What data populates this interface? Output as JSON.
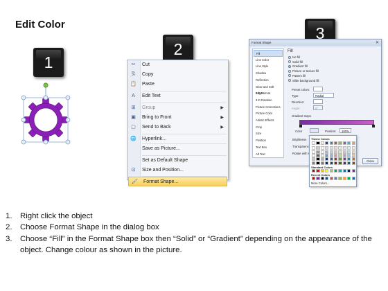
{
  "title": "Edit Color",
  "badges": [
    "1",
    "2",
    "3"
  ],
  "context_menu": {
    "items": [
      {
        "label": "Cut",
        "icon": "scissors-icon",
        "glyph": "✂",
        "disabled": false,
        "submenu": false
      },
      {
        "label": "Copy",
        "icon": "copy-icon",
        "glyph": "⎘",
        "disabled": false,
        "submenu": false
      },
      {
        "label": "Paste",
        "icon": "paste-icon",
        "glyph": "📋",
        "disabled": false,
        "submenu": false
      },
      {
        "label": "Edit Text",
        "icon": "edit-text-icon",
        "glyph": "A",
        "disabled": false,
        "submenu": false
      },
      {
        "label": "Group",
        "icon": "group-icon",
        "glyph": "⊞",
        "disabled": true,
        "submenu": true
      },
      {
        "label": "Bring to Front",
        "icon": "bring-front-icon",
        "glyph": "▣",
        "disabled": false,
        "submenu": true
      },
      {
        "label": "Send to Back",
        "icon": "send-back-icon",
        "glyph": "▢",
        "disabled": false,
        "submenu": true
      },
      {
        "label": "Hyperlink...",
        "icon": "hyperlink-icon",
        "glyph": "🌐",
        "disabled": false,
        "submenu": false
      },
      {
        "label": "Save as Picture...",
        "icon": "",
        "glyph": "",
        "disabled": false,
        "submenu": false
      },
      {
        "label": "Set as Default Shape",
        "icon": "",
        "glyph": "",
        "disabled": false,
        "submenu": false
      },
      {
        "label": "Size and Position...",
        "icon": "size-position-icon",
        "glyph": "⊡",
        "disabled": false,
        "submenu": false
      },
      {
        "label": "Format Shape...",
        "icon": "format-shape-icon",
        "glyph": "🖌",
        "disabled": false,
        "submenu": false,
        "highlight": true
      }
    ]
  },
  "dialog": {
    "title": "Format Shape",
    "close_glyph": "✕",
    "nav": [
      "Fill",
      "Line Color",
      "Line Style",
      "Shadow",
      "Reflection",
      "Glow and Soft Edges",
      "3-D Format",
      "3-D Rotation",
      "Picture Corrections",
      "Picture Color",
      "Artistic Effects",
      "Crop",
      "Size",
      "Position",
      "Text Box",
      "Alt Text"
    ],
    "section_heading": "Fill",
    "options": [
      "No fill",
      "Solid fill",
      "Gradient fill",
      "Picture or texture fill",
      "Pattern fill",
      "Slide background fill"
    ],
    "selected_option": "Gradient fill",
    "labels": {
      "preset": "Preset colors:",
      "type": "Type:",
      "type_value": "Radial",
      "direction": "Direction:",
      "angle": "Angle:",
      "angle_value": "0°",
      "stops": "Gradient stops",
      "color": "Color",
      "position": "Position:",
      "position_value": "100%",
      "brightness": "Brightness",
      "transparency": "Transparency",
      "rotate": "Rotate with shape",
      "close": "Close"
    },
    "gradient_colors": [
      "#7a2fa0",
      "#c760c8"
    ]
  },
  "palette": {
    "theme_label": "Theme Colors",
    "standard_label": "Standard Colors",
    "recent_label": "Recent Colors",
    "more_label": "More Colors...",
    "theme_top": [
      "#ffffff",
      "#000000",
      "#eeece1",
      "#1f497d",
      "#4f81bd",
      "#c0504d",
      "#9bbb59",
      "#8064a2",
      "#4bacc6",
      "#f79646"
    ],
    "standard": [
      "#c00000",
      "#ff0000",
      "#ffc000",
      "#ffff00",
      "#92d050",
      "#00b050",
      "#00b0f0",
      "#0070c0",
      "#002060",
      "#7030a0"
    ],
    "recent": [
      "#c00000",
      "#7030a0",
      "#000000",
      "#1f497d",
      "#c0504d",
      "#4f81bd",
      "#9bbb59",
      "#f79646",
      "#00b050",
      "#0070c0"
    ]
  },
  "steps": [
    {
      "num": "1.",
      "text": "Right click the object"
    },
    {
      "num": "2.",
      "text": "Choose Format Shape in the dialog box"
    },
    {
      "num": "3.",
      "text": "Choose “Fill” in the Format Shape box then “Solid” or “Gradient” depending on the appearance of the object. Change colour as shown in the picture."
    }
  ],
  "colors": {
    "gear": "#8b1fb8",
    "handle": "#7bc043",
    "menu_highlight": "#f8cf5a"
  }
}
